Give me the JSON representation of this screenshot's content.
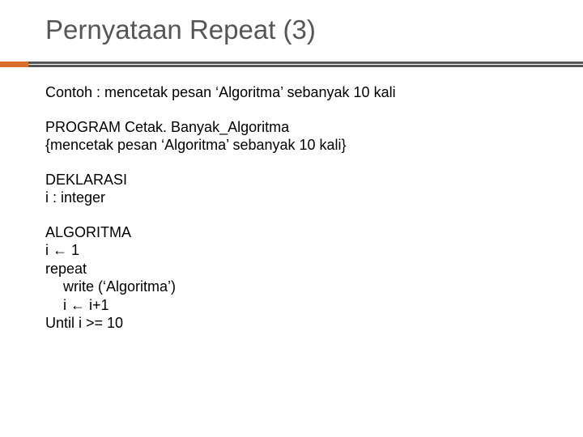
{
  "title": "Pernyataan Repeat (3)",
  "example_line": "Contoh : mencetak pesan ‘Algoritma’ sebanyak 10 kali",
  "program": {
    "header": "PROGRAM Cetak. Banyak_Algoritma",
    "comment": "{mencetak pesan ‘Algoritma’ sebanyak 10 kali}"
  },
  "declaration": {
    "label": "DEKLARASI",
    "line1": "i : integer"
  },
  "algorithm": {
    "label": "ALGORITMA",
    "line1": "i ← 1",
    "line2": "repeat",
    "line3": "write (‘Algoritma’)",
    "line4": "i ← i+1",
    "line5": "Until i >= 10"
  }
}
